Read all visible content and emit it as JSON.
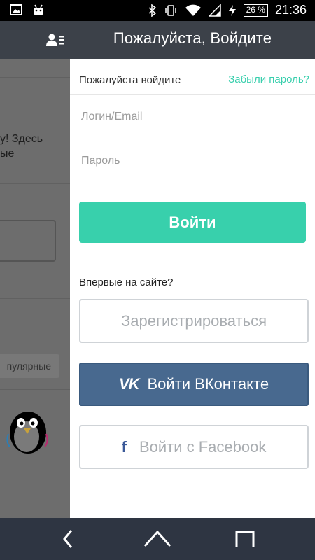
{
  "status_bar": {
    "icons": [
      "image-icon",
      "android-icon",
      "bluetooth-icon",
      "vibrate-icon",
      "wifi-icon",
      "signal-icon",
      "charging-icon"
    ],
    "battery": "26 %",
    "time": "21:36"
  },
  "header": {
    "title": "Пожалуйста, Войдите",
    "left_icon": "contacts-icon"
  },
  "background_page": {
    "text_line1": "у! Здесь",
    "text_line2": "ые",
    "chip": "пулярные"
  },
  "login": {
    "prompt": "Пожалуйста войдите",
    "forgot": "Забыли пароль?",
    "login_placeholder": "Логин/Email",
    "password_placeholder": "Пароль",
    "submit": "Войти",
    "first_time": "Впервые на сайте?",
    "register": "Зарегистрироваться",
    "vk_logo": "VK",
    "vk": "Войти ВКонтакте",
    "fb_logo": "f",
    "fb": "Войти с Facebook"
  },
  "colors": {
    "accent": "#38d0ac",
    "header": "#3c4149",
    "vk": "#48698f",
    "nav": "#2e3542"
  },
  "nav": {
    "icons": [
      "back-icon",
      "home-icon",
      "recents-icon"
    ]
  }
}
